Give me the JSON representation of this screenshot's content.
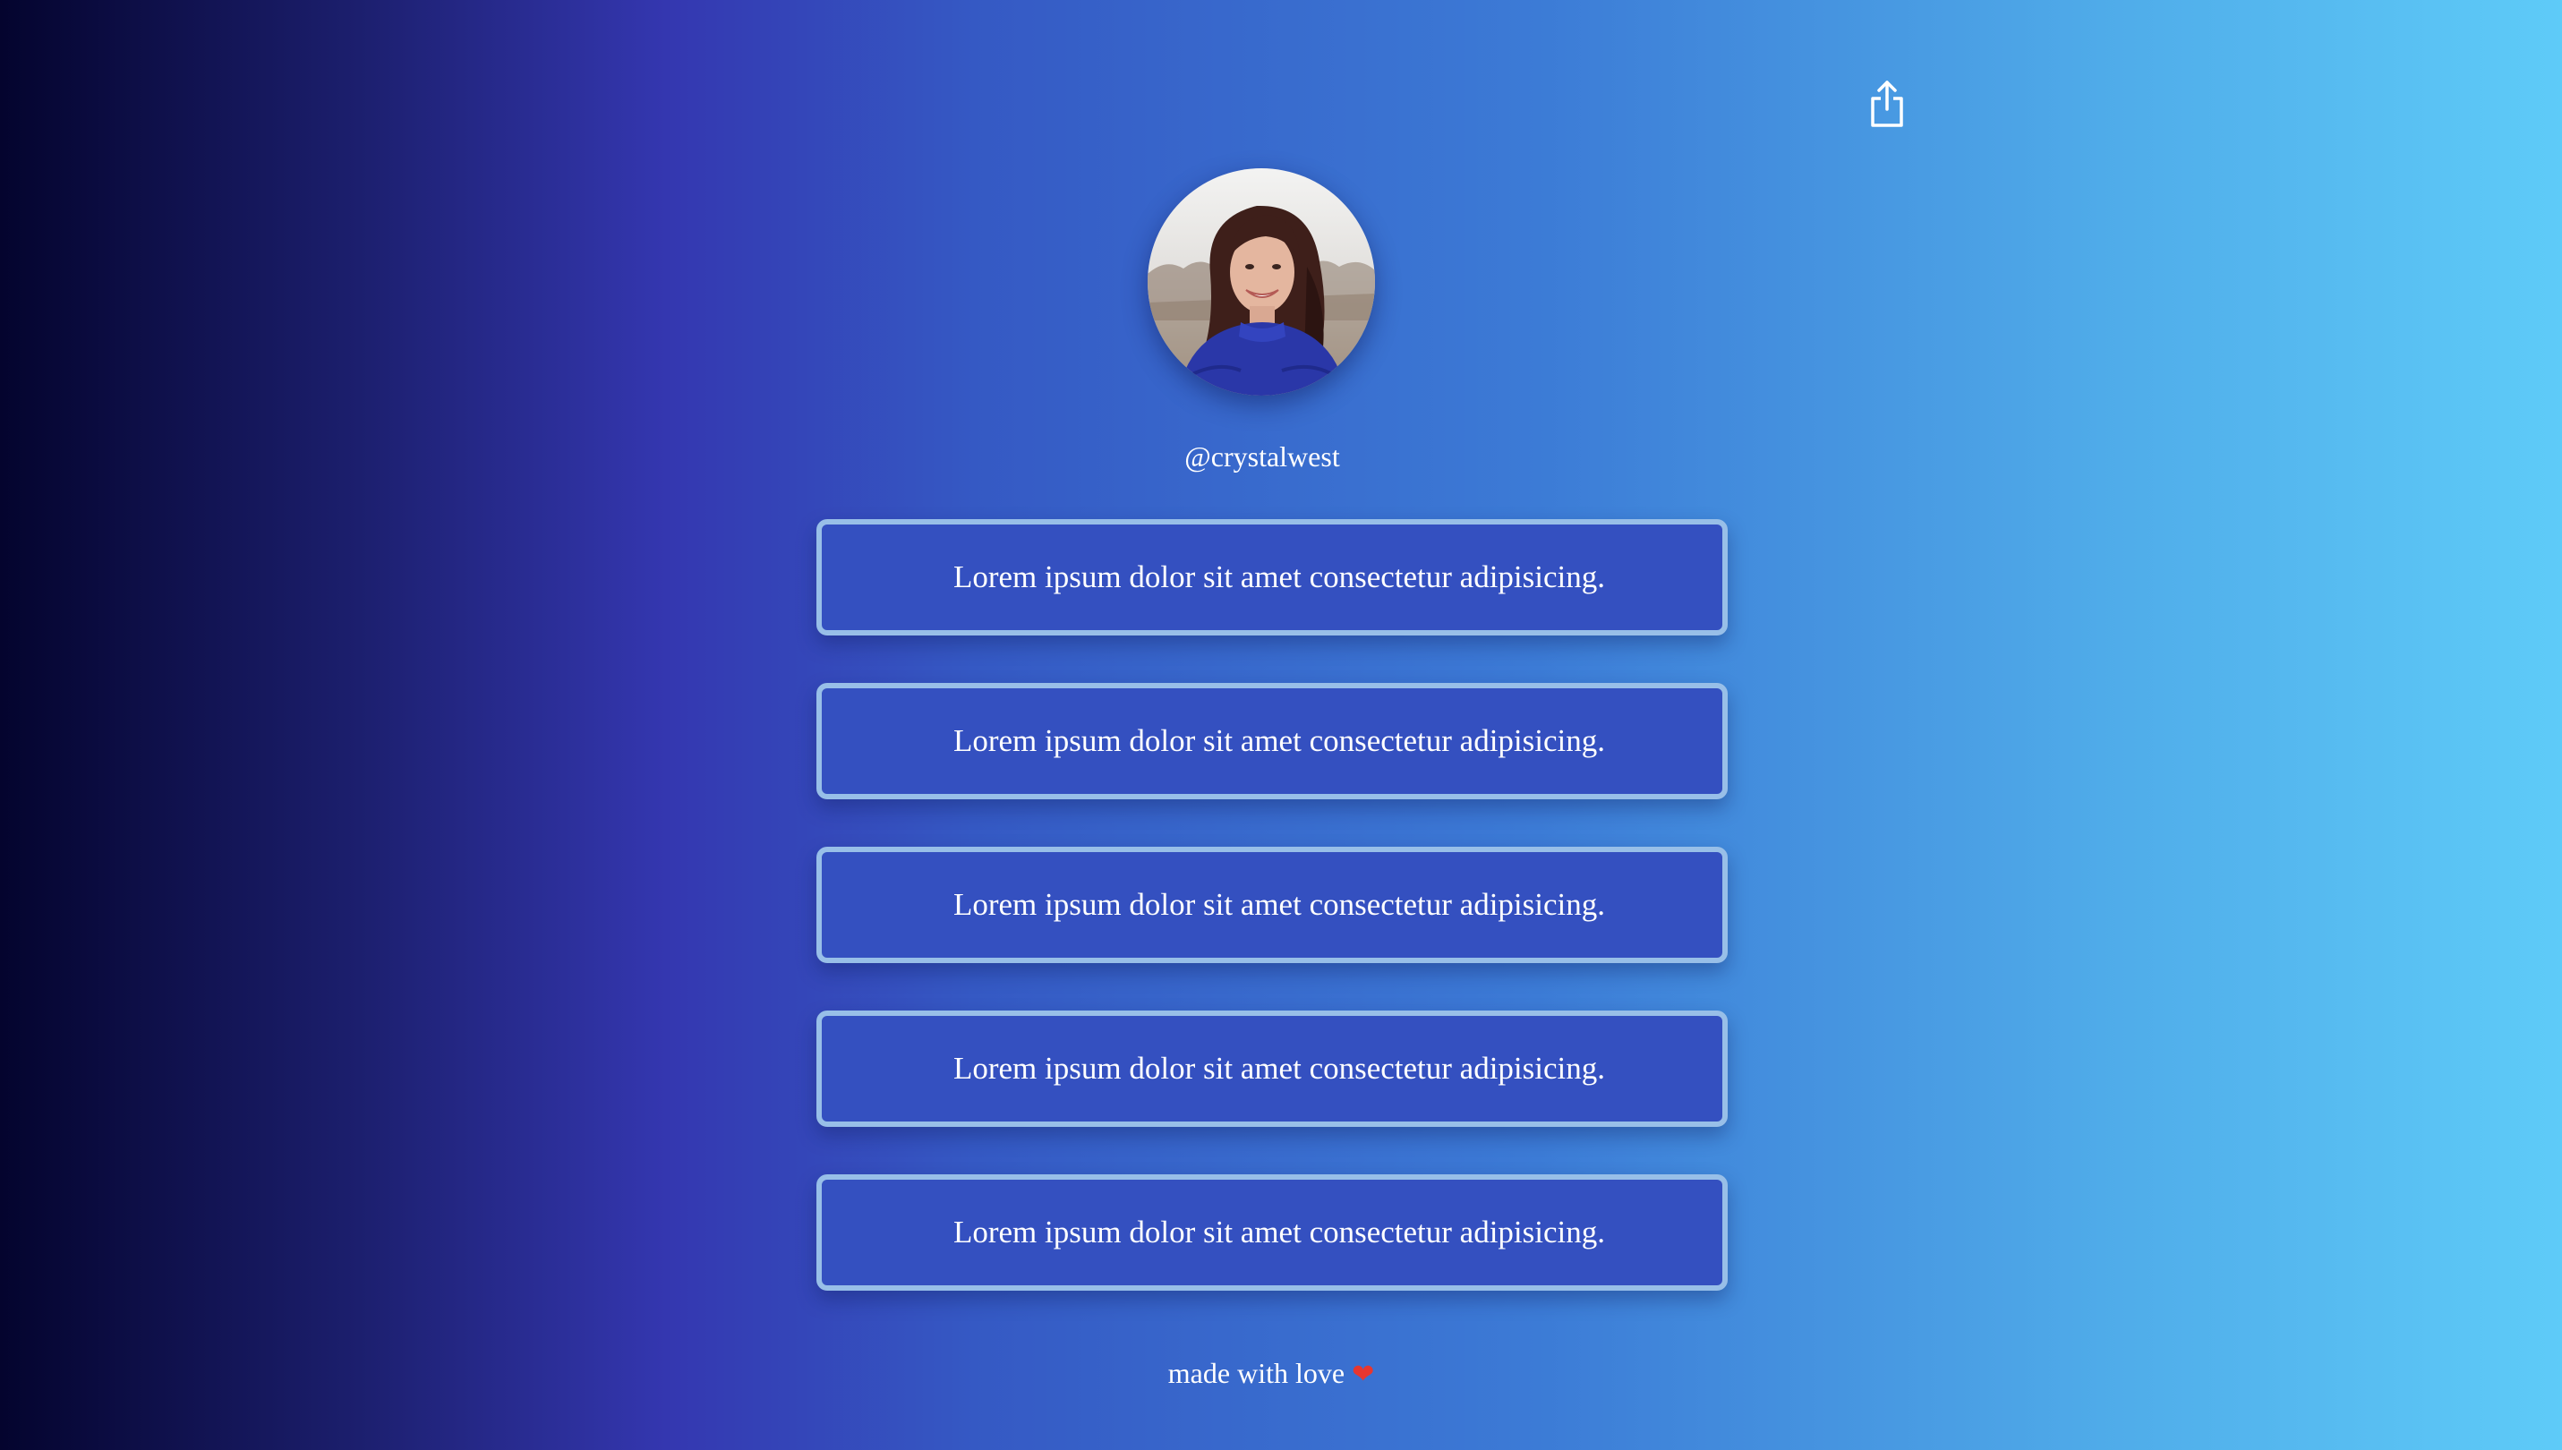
{
  "profile": {
    "handle": "@crystalwest",
    "avatar_alt": "profile photo"
  },
  "share": {
    "icon": "share-icon"
  },
  "links": [
    {
      "label": "Lorem ipsum dolor sit amet consectetur adipisicing."
    },
    {
      "label": "Lorem ipsum dolor sit amet consectetur adipisicing."
    },
    {
      "label": "Lorem ipsum dolor sit amet consectetur adipisicing."
    },
    {
      "label": "Lorem ipsum dolor sit amet consectetur adipisicing."
    },
    {
      "label": "Lorem ipsum dolor sit amet consectetur adipisicing."
    }
  ],
  "footer": {
    "text": "made with love",
    "heart": "❤"
  },
  "colors": {
    "background_left": "#04042e",
    "background_mid": "#3437b0",
    "background_right": "#5ecbf8",
    "button_fill": "#3450c0",
    "button_border": "#98bfe8",
    "heart": "#e8362f"
  }
}
